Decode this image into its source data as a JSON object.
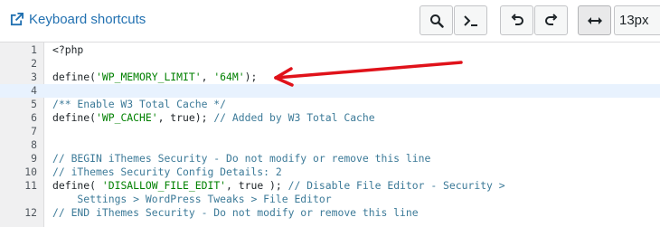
{
  "toolbar": {
    "shortcuts_label": "Keyboard shortcuts",
    "font_size_value": "13px",
    "buttons": [
      {
        "name": "search-button",
        "icon": "search-icon"
      },
      {
        "name": "terminal-button",
        "icon": "terminal-icon"
      },
      {
        "name": "undo-button",
        "icon": "undo-icon"
      },
      {
        "name": "redo-button",
        "icon": "redo-icon"
      },
      {
        "name": "toggle-width-button",
        "icon": "horizontal-arrows-icon"
      }
    ]
  },
  "editor": {
    "lines": [
      {
        "num": "1",
        "parts": [
          {
            "t": "<?php",
            "c": ""
          }
        ]
      },
      {
        "num": "2",
        "parts": []
      },
      {
        "num": "3",
        "parts": [
          {
            "t": "define(",
            "c": ""
          },
          {
            "t": "'WP_MEMORY_LIMIT'",
            "c": "str"
          },
          {
            "t": ", ",
            "c": ""
          },
          {
            "t": "'64M'",
            "c": "str"
          },
          {
            "t": ");",
            "c": ""
          }
        ]
      },
      {
        "num": "4",
        "parts": [],
        "current": true
      },
      {
        "num": "5",
        "parts": [
          {
            "t": "/** Enable W3 Total Cache */",
            "c": "com"
          }
        ]
      },
      {
        "num": "6",
        "parts": [
          {
            "t": "define(",
            "c": ""
          },
          {
            "t": "'WP_CACHE'",
            "c": "str"
          },
          {
            "t": ", true); ",
            "c": ""
          },
          {
            "t": "// Added by W3 Total Cache",
            "c": "com"
          }
        ]
      },
      {
        "num": "7",
        "parts": []
      },
      {
        "num": "8",
        "parts": []
      },
      {
        "num": "9",
        "parts": [
          {
            "t": "// BEGIN iThemes Security - Do not modify or remove this line",
            "c": "com"
          }
        ]
      },
      {
        "num": "10",
        "parts": [
          {
            "t": "// iThemes Security Config Details: 2",
            "c": "com"
          }
        ]
      },
      {
        "num": "11",
        "parts": [
          {
            "t": "define( ",
            "c": ""
          },
          {
            "t": "'DISALLOW_FILE_EDIT'",
            "c": "str"
          },
          {
            "t": ", true ); ",
            "c": ""
          },
          {
            "t": "// Disable File Editor - Security >",
            "c": "com"
          }
        ]
      },
      {
        "num": "",
        "parts": [
          {
            "t": "    Settings > WordPress Tweaks > File Editor",
            "c": "com"
          }
        ]
      },
      {
        "num": "12",
        "parts": [
          {
            "t": "// END iThemes Security - Do not modify or remove this line",
            "c": "com"
          }
        ]
      }
    ]
  },
  "annotation": {
    "color": "#e0121a"
  }
}
